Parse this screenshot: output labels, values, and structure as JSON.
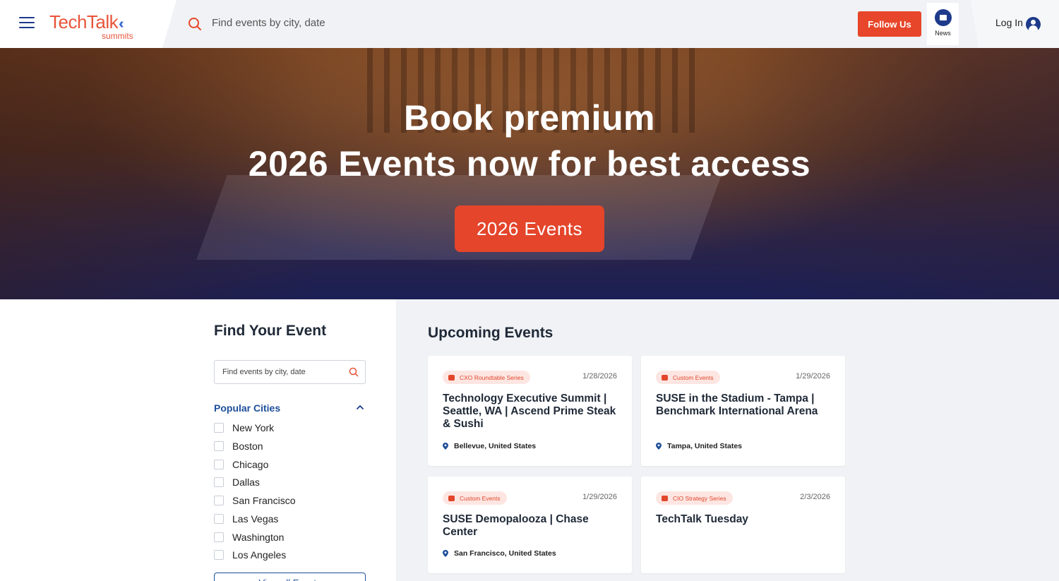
{
  "header": {
    "logo_main": "TechTalk",
    "logo_sub": "summits",
    "search_placeholder": "Find events by city, date",
    "follow_label": "Follow Us",
    "news_label": "News",
    "login_label": "Log In"
  },
  "hero": {
    "title_line1": "Book premium",
    "title_line2": "2026 Events now for best access",
    "button_label": "2026 Events"
  },
  "filter": {
    "title": "Find Your Event",
    "search_placeholder": "Find events by city, date",
    "popular_title": "Popular Cities",
    "cities": [
      "New York",
      "Boston",
      "Chicago",
      "Dallas",
      "San Francisco",
      "Las Vegas",
      "Washington",
      "Los Angeles"
    ],
    "view_all_label": "View all Events"
  },
  "events": {
    "title": "Upcoming Events",
    "cards": [
      {
        "tag": "CXO Roundtable Series",
        "date": "1/28/2026",
        "title": "Technology Executive Summit | Seattle, WA | Ascend Prime Steak & Sushi",
        "location": "Bellevue, United States"
      },
      {
        "tag": "Custom Events",
        "date": "1/29/2026",
        "title": "SUSE in the Stadium - Tampa | Benchmark International Arena",
        "location": "Tampa, United States"
      },
      {
        "tag": "Custom Events",
        "date": "1/29/2026",
        "title": "SUSE Demopalooza | Chase Center",
        "location": "San Francisco, United States"
      },
      {
        "tag": "CIO Strategy Series",
        "date": "2/3/2026",
        "title": "TechTalk Tuesday",
        "location": ""
      }
    ]
  },
  "colors": {
    "accent": "#e8462a",
    "brand_blue": "#1e3a8a",
    "link_blue": "#1e4f9a",
    "tag_bg": "#fde6e2"
  }
}
